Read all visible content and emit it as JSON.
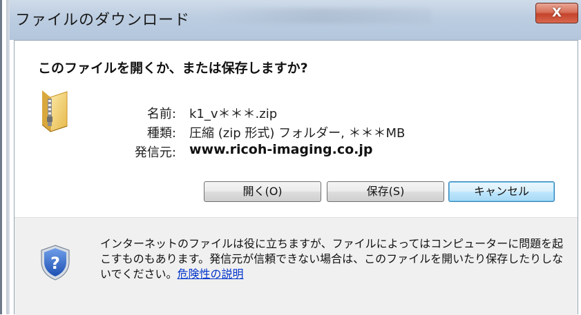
{
  "window": {
    "title": "ファイルのダウンロード",
    "close_label": "X"
  },
  "dialog": {
    "question": "このファイルを開くか、または保存しますか?",
    "icon": "zip-folder-icon",
    "fields": {
      "name_label": "名前:",
      "name_value": "k1_v＊＊＊.zip",
      "type_label": "種類:",
      "type_value": "圧縮 (zip 形式) フォルダー, ＊＊＊MB",
      "from_label": "発信元:",
      "from_value": "www.ricoh-imaging.co.jp"
    },
    "buttons": {
      "open": "開く(O)",
      "save": "保存(S)",
      "cancel": "キャンセル"
    }
  },
  "footer": {
    "icon": "security-shield-question-icon",
    "warning": "インターネットのファイルは役に立ちますが、ファイルによってはコンピューターに問題を起こすものもあります。発信元が信頼できない場合は、このファイルを開いたり保存したりしないでください。",
    "link": "危険性の説明"
  },
  "colors": {
    "titlebar": "#bccde1",
    "close_button": "#c4432b",
    "default_button": "#bee6fd",
    "link": "#0033cc",
    "footer_bg": "#f0f0f0"
  }
}
